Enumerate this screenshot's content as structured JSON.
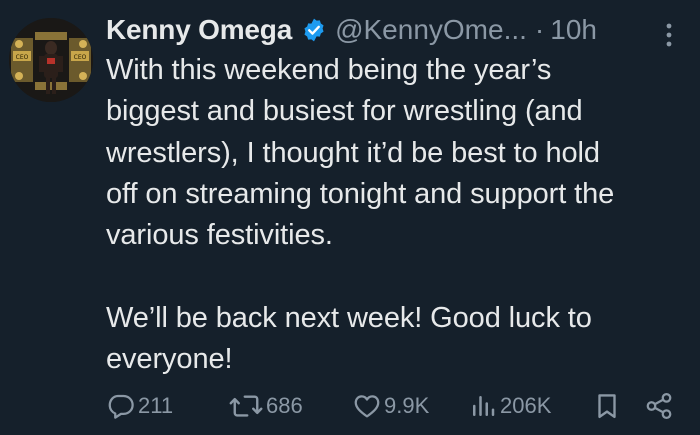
{
  "tweet": {
    "author": {
      "display_name": "Kenny Omega",
      "handle": "@KennyOme...",
      "verified": true
    },
    "separator": "·",
    "time": "10h",
    "paragraphs": [
      [
        "With this weekend being the year’s",
        "biggest and busiest for wrestling (and",
        "wrestlers), I thought it’d be best to hold",
        "off on streaming tonight and support the",
        "various festivities."
      ],
      [
        "We’ll be back next week! Good luck to",
        "everyone!"
      ]
    ],
    "actions": {
      "replies": "211",
      "reposts": "686",
      "likes": "9.9K",
      "views": "206K"
    },
    "avatar_text": [
      "CEO",
      "CEO"
    ]
  },
  "colors": {
    "background": "#15202b",
    "text": "#e7e9ea",
    "muted": "#8b98a5",
    "verified": "#1d9bf0"
  },
  "icons": {
    "verified": "verified-badge-icon",
    "more": "more-dots-icon",
    "reply": "reply-icon",
    "repost": "repost-icon",
    "like": "heart-icon",
    "views": "views-bar-chart-icon",
    "bookmark": "bookmark-icon",
    "share": "share-icon"
  }
}
